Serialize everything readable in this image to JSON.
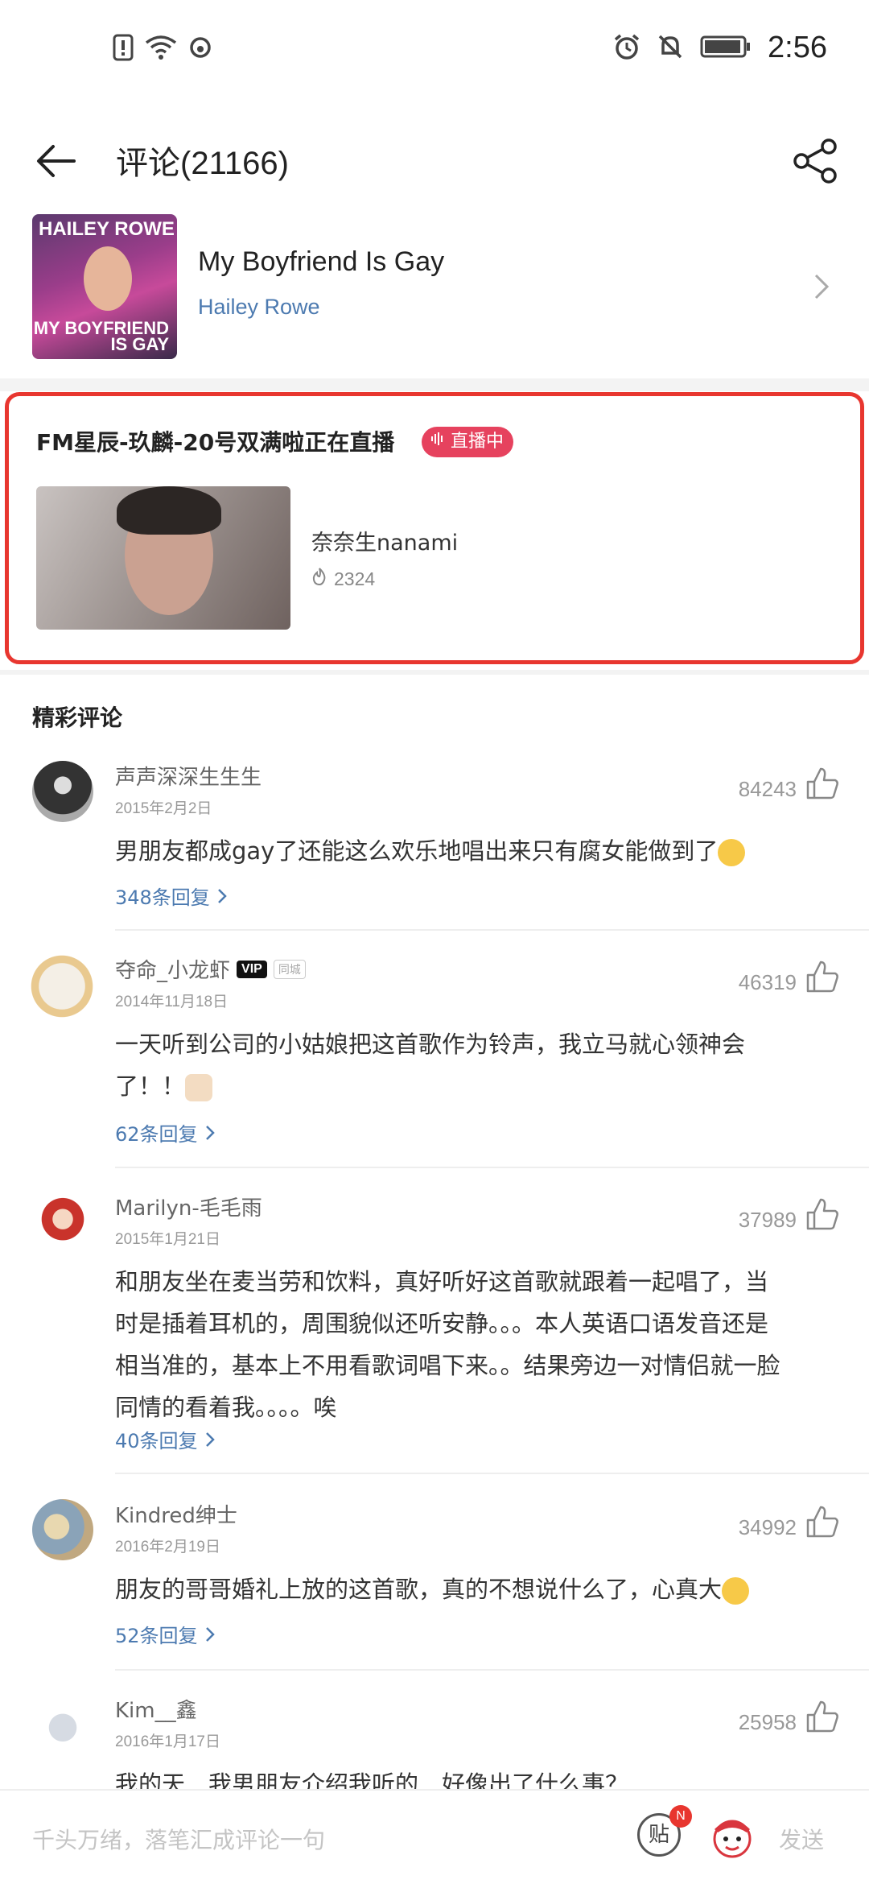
{
  "status_bar": {
    "time": "2:56"
  },
  "header": {
    "title": "评论(21166)"
  },
  "song": {
    "name": "My Boyfriend Is Gay",
    "artist": "Hailey Rowe",
    "cover_text_top": "HAILEY ROWE",
    "cover_text_bottom": "MY BOYFRIEND IS GAY"
  },
  "live": {
    "title": "FM星辰-玖麟-20号双满啦正在直播",
    "badge": "直播中",
    "host": "奈奈生nanami",
    "heat": "2324"
  },
  "section_title": "精彩评论",
  "comments": [
    {
      "user": "声声深深生生生",
      "date": "2015年2月2日",
      "likes": "84243",
      "text": "男朋友都成gay了还能这么欢乐地唱出来只有腐女能做到了",
      "replies": "348条回复"
    },
    {
      "user": "夺命_小龙虾",
      "vip": "VIP",
      "tag": "同城",
      "date": "2014年11月18日",
      "likes": "46319",
      "text": "一天听到公司的小姑娘把这首歌作为铃声，我立马就心领神会了！！",
      "replies": "62条回复"
    },
    {
      "user": "Marilyn-毛毛雨",
      "date": "2015年1月21日",
      "likes": "37989",
      "text": "和朋友坐在麦当劳和饮料，真好听好这首歌就跟着一起唱了，当时是插着耳机的，周围貌似还听安静。。。本人英语口语发音还是相当准的，基本上不用看歌词唱下来。。结果旁边一对情侣就一脸同情的看着我。。。。唉",
      "replies": "40条回复"
    },
    {
      "user": "Kindred绅士",
      "date": "2016年2月19日",
      "likes": "34992",
      "text": "朋友的哥哥婚礼上放的这首歌，真的不想说什么了，心真大",
      "replies": "52条回复"
    },
    {
      "user": "Kim__鑫",
      "date": "2016年1月17日",
      "likes": "25958",
      "text": "我的天…我男朋友介绍我听的…好像出了什么事？"
    }
  ],
  "bottom_bar": {
    "placeholder": "千头万绪，落笔汇成评论一句",
    "tie_label": "贴",
    "tie_badge": "N",
    "send": "发送"
  }
}
